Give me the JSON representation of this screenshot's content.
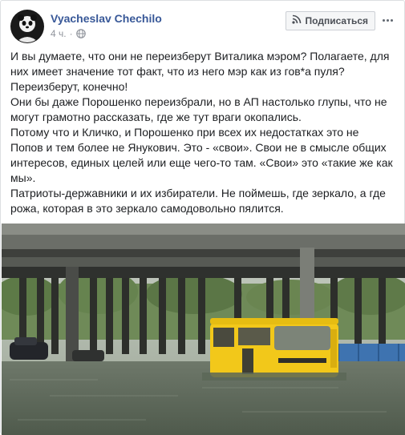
{
  "post": {
    "author": "Vyacheslav Chechilo",
    "time": "4 ч.",
    "separator": "·",
    "subscribe_label": "Подписаться",
    "paragraphs": [
      "И вы думаете, что они не переизберут Виталика мэром? Полагаете, для них имеет значение тот факт, что из него мэр как из гов*а пуля?",
      "Переизберут, конечно!",
      "Они бы даже Порошенко переизбрали, но в АП настолько глупы, что не могут грамотно рассказать, где же тут враги окопались.",
      "Потому что и Кличко, и Порошенко при всех их недостатках это не Попов и тем более не Янукович. Это - «свои». Свои не в смысле общих интересов, единых целей или еще чего-то там. «Свои» это «такие же как мы».",
      "Патриоты-державники и их избиратели. Не поймешь, где зеркало, а где рожа, которая в это зеркало самодовольно пялится."
    ]
  },
  "icons": {
    "avatar": "avatar-image",
    "privacy": "globe-icon",
    "subscribe": "rss-icon",
    "more": "more-options-icon"
  },
  "colors": {
    "author": "#385898",
    "meta": "#90949c",
    "bus": "#f2c81a",
    "water": "#5e6a58"
  }
}
